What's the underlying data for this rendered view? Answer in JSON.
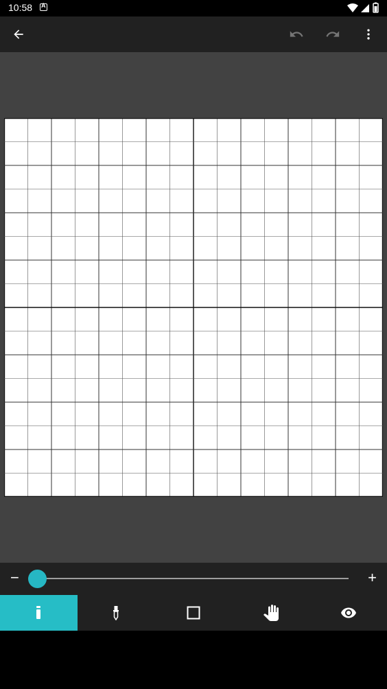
{
  "status_bar": {
    "time": "10:58",
    "icons": [
      "notification-icon",
      "wifi-icon",
      "signal-icon",
      "battery-icon"
    ]
  },
  "toolbar": {
    "back_icon": "arrow-left-icon",
    "undo_icon": "undo-icon",
    "redo_icon": "redo-icon",
    "menu_icon": "more-vert-icon"
  },
  "canvas": {
    "grid_cols": 16,
    "grid_rows": 16,
    "major_every": 8,
    "minor_every": 2
  },
  "slider": {
    "minus_label": "−",
    "plus_label": "+",
    "value": 0.0,
    "accent": "#26b7c3"
  },
  "tools": [
    {
      "name": "pencil-tool",
      "icon": "pencil-icon",
      "active": true
    },
    {
      "name": "eyedropper-tool",
      "icon": "eyedropper-icon",
      "active": false
    },
    {
      "name": "rectangle-tool",
      "icon": "square-icon",
      "active": false
    },
    {
      "name": "pan-tool",
      "icon": "hand-icon",
      "active": false
    },
    {
      "name": "preview-tool",
      "icon": "eye-icon",
      "active": false
    }
  ],
  "colors": {
    "toolbar_bg": "#212121",
    "canvas_bg": "#424242",
    "active_tool_bg": "#26bdc6"
  }
}
